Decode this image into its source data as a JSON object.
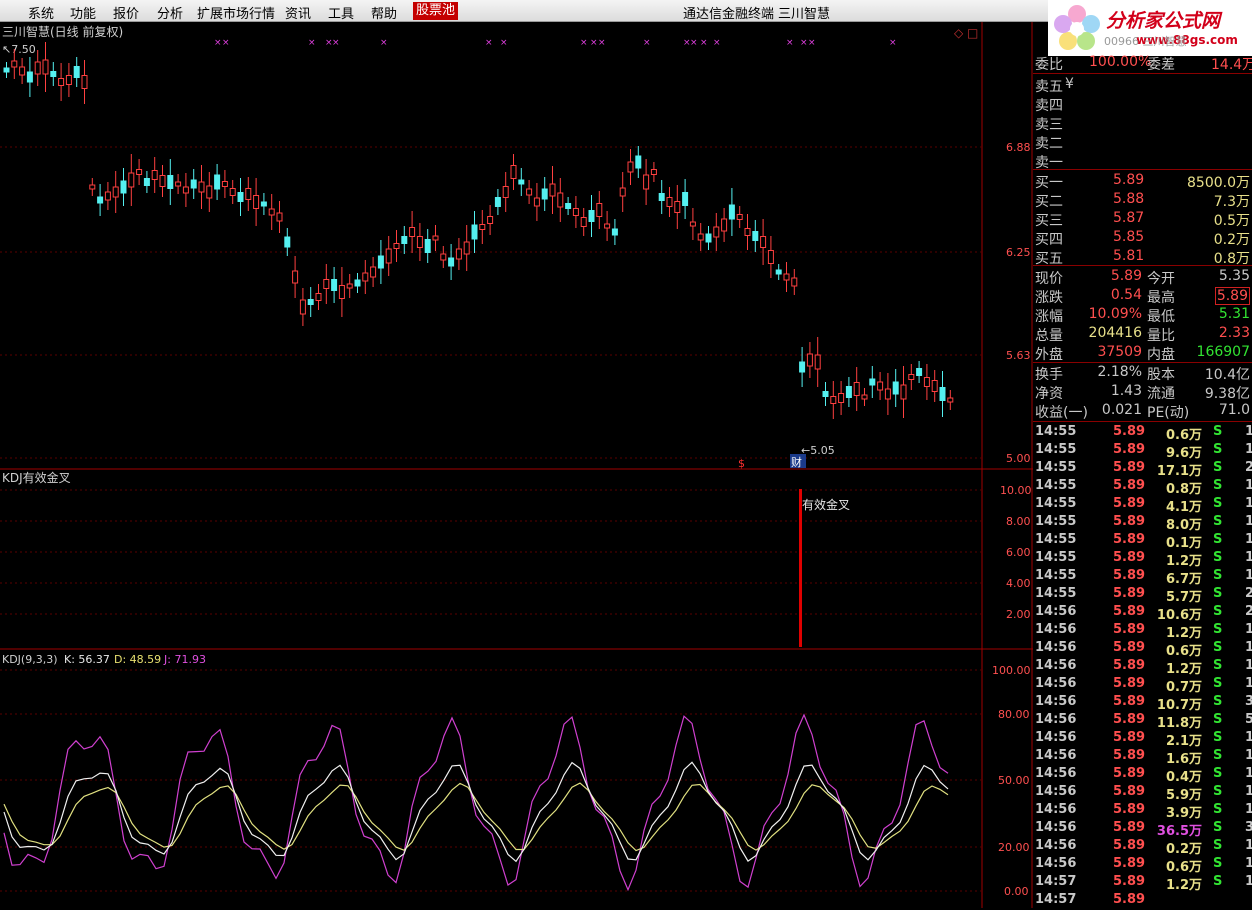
{
  "menu": {
    "items": [
      "系统",
      "功能",
      "报价",
      "分析",
      "扩展市场行情",
      "资讯",
      "工具",
      "帮助"
    ],
    "highlight": "股票池",
    "center_title": "通达信金融终端",
    "center_name": "三川智慧"
  },
  "logo": {
    "text": "分析家公式网",
    "url": "www.88gs.com",
    "faded": "00966 三川智慧"
  },
  "main_chart": {
    "title": "三川智慧(日线 前复权)",
    "high_marker": "7.50",
    "low_marker": "5.05",
    "price_levels": [
      "6.88",
      "6.25",
      "5.63",
      "5.00"
    ],
    "badge_s": "$",
    "badge_cai": "财"
  },
  "kdj_signal_panel": {
    "title": "KDJ有效金叉",
    "levels": [
      "10.00",
      "8.00",
      "6.00",
      "4.00",
      "2.00"
    ],
    "signal_label": "有效金叉"
  },
  "kdj_panel": {
    "prefix": "KDJ(9,3,3)",
    "k": "K: 56.37",
    "d": "D: 48.59",
    "j": "J: 71.93",
    "levels": [
      "100.00",
      "80.00",
      "50.00",
      "20.00",
      "0.00"
    ]
  },
  "quote": {
    "webi_label": "委比",
    "webi_value": "100.00%",
    "weicha_label": "委差",
    "weicha_value": "14.4万",
    "sell": [
      {
        "label": "卖五",
        "price": "",
        "vol": "",
        "mark": "¥"
      },
      {
        "label": "卖四",
        "price": "",
        "vol": ""
      },
      {
        "label": "卖三",
        "price": "",
        "vol": ""
      },
      {
        "label": "卖二",
        "price": "",
        "vol": ""
      },
      {
        "label": "卖一",
        "price": "",
        "vol": ""
      }
    ],
    "buy": [
      {
        "label": "买一",
        "price": "5.89",
        "vol": "8500.0万"
      },
      {
        "label": "买二",
        "price": "5.88",
        "vol": "7.3万"
      },
      {
        "label": "买三",
        "price": "5.87",
        "vol": "0.5万"
      },
      {
        "label": "买四",
        "price": "5.85",
        "vol": "0.2万"
      },
      {
        "label": "买五",
        "price": "5.81",
        "vol": "0.8万"
      }
    ],
    "stats": [
      {
        "l1": "现价",
        "v1": "5.89",
        "c1": "red",
        "l2": "今开",
        "v2": "5.35",
        "c2": "lbl"
      },
      {
        "l1": "涨跌",
        "v1": "0.54",
        "c1": "red",
        "l2": "最高",
        "v2": "5.89",
        "c2": "red"
      },
      {
        "l1": "涨幅",
        "v1": "10.09%",
        "c1": "red",
        "l2": "最低",
        "v2": "5.31",
        "c2": "grn"
      },
      {
        "l1": "总量",
        "v1": "204416",
        "c1": "yel",
        "l2": "量比",
        "v2": "2.33",
        "c2": "red"
      },
      {
        "l1": "外盘",
        "v1": "37509",
        "c1": "red",
        "l2": "内盘",
        "v2": "166907",
        "c2": "grn"
      }
    ],
    "stats2": [
      {
        "l1": "换手",
        "v1": "2.18%",
        "l2": "股本",
        "v2": "10.4亿"
      },
      {
        "l1": "净资",
        "v1": "1.43",
        "l2": "流通",
        "v2": "9.38亿"
      },
      {
        "l1": "收益(一)",
        "v1": "0.021",
        "l2": "PE(动)",
        "v2": "71.0"
      }
    ]
  },
  "ticks": [
    {
      "t": "14:55",
      "p": "5.89",
      "v": "0.6万",
      "s": "S",
      "n": "1"
    },
    {
      "t": "14:55",
      "p": "5.89",
      "v": "9.6万",
      "s": "S",
      "n": "1"
    },
    {
      "t": "14:55",
      "p": "5.89",
      "v": "17.1万",
      "s": "S",
      "n": "2"
    },
    {
      "t": "14:55",
      "p": "5.89",
      "v": "0.8万",
      "s": "S",
      "n": "1"
    },
    {
      "t": "14:55",
      "p": "5.89",
      "v": "4.1万",
      "s": "S",
      "n": "1"
    },
    {
      "t": "14:55",
      "p": "5.89",
      "v": "8.0万",
      "s": "S",
      "n": "1"
    },
    {
      "t": "14:55",
      "p": "5.89",
      "v": "0.1万",
      "s": "S",
      "n": "1"
    },
    {
      "t": "14:55",
      "p": "5.89",
      "v": "1.2万",
      "s": "S",
      "n": "1"
    },
    {
      "t": "14:55",
      "p": "5.89",
      "v": "6.7万",
      "s": "S",
      "n": "1"
    },
    {
      "t": "14:55",
      "p": "5.89",
      "v": "5.7万",
      "s": "S",
      "n": "2"
    },
    {
      "t": "14:56",
      "p": "5.89",
      "v": "10.6万",
      "s": "S",
      "n": "2"
    },
    {
      "t": "14:56",
      "p": "5.89",
      "v": "1.2万",
      "s": "S",
      "n": "1"
    },
    {
      "t": "14:56",
      "p": "5.89",
      "v": "0.6万",
      "s": "S",
      "n": "1"
    },
    {
      "t": "14:56",
      "p": "5.89",
      "v": "1.2万",
      "s": "S",
      "n": "1"
    },
    {
      "t": "14:56",
      "p": "5.89",
      "v": "0.7万",
      "s": "S",
      "n": "1"
    },
    {
      "t": "14:56",
      "p": "5.89",
      "v": "10.7万",
      "s": "S",
      "n": "3"
    },
    {
      "t": "14:56",
      "p": "5.89",
      "v": "11.8万",
      "s": "S",
      "n": "5"
    },
    {
      "t": "14:56",
      "p": "5.89",
      "v": "2.1万",
      "s": "S",
      "n": "1"
    },
    {
      "t": "14:56",
      "p": "5.89",
      "v": "1.6万",
      "s": "S",
      "n": "1"
    },
    {
      "t": "14:56",
      "p": "5.89",
      "v": "0.4万",
      "s": "S",
      "n": "1"
    },
    {
      "t": "14:56",
      "p": "5.89",
      "v": "5.9万",
      "s": "S",
      "n": "1"
    },
    {
      "t": "14:56",
      "p": "5.89",
      "v": "3.9万",
      "s": "S",
      "n": "1"
    },
    {
      "t": "14:56",
      "p": "5.89",
      "v": "36.5万",
      "s": "S",
      "n": "3",
      "hl": true
    },
    {
      "t": "14:56",
      "p": "5.89",
      "v": "0.2万",
      "s": "S",
      "n": "1"
    },
    {
      "t": "14:56",
      "p": "5.89",
      "v": "0.6万",
      "s": "S",
      "n": "1"
    },
    {
      "t": "14:57",
      "p": "5.89",
      "v": "1.2万",
      "s": "S",
      "n": "1"
    },
    {
      "t": "14:57",
      "p": "5.89",
      "v": "",
      "s": "",
      "n": ""
    }
  ]
}
